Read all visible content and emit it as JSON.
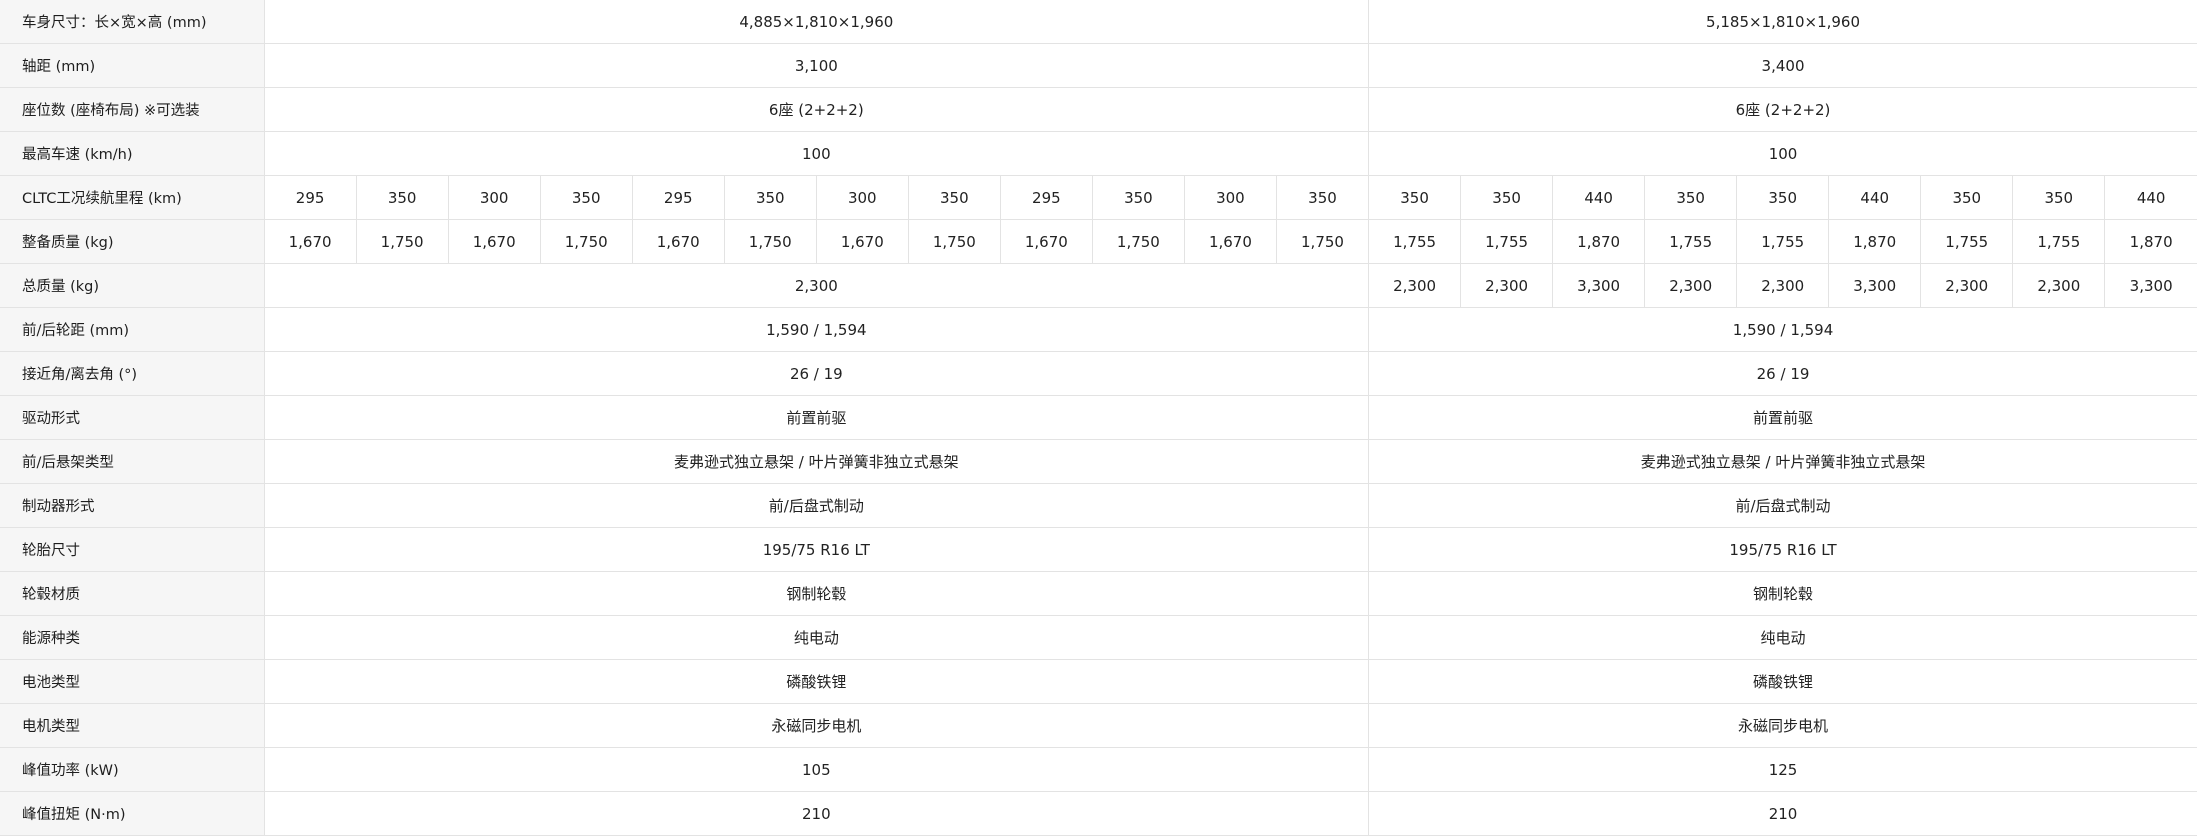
{
  "rows": [
    {
      "label": "车身尺寸：长×宽×高 (mm)",
      "type": "span",
      "left": "4,885×1,810×1,960",
      "right": "5,185×1,810×1,960"
    },
    {
      "label": "轴距 (mm)",
      "type": "span",
      "left": "3,100",
      "right": "3,400"
    },
    {
      "label": "座位数 (座椅布局) ※可选装",
      "type": "span",
      "left": "6座 (2+2+2)",
      "right": "6座 (2+2+2)"
    },
    {
      "label": "最高车速 (km/h)",
      "type": "span",
      "left": "100",
      "right": "100"
    },
    {
      "label": "CLTC工况续航里程 (km)",
      "type": "cells",
      "left": [
        "295",
        "350",
        "300",
        "350",
        "295",
        "350",
        "300",
        "350",
        "295",
        "350",
        "300",
        "350"
      ],
      "right": [
        "350",
        "350",
        "440",
        "350",
        "350",
        "440",
        "350",
        "350",
        "440"
      ]
    },
    {
      "label": "整备质量 (kg)",
      "type": "cells",
      "left": [
        "1,670",
        "1,750",
        "1,670",
        "1,750",
        "1,670",
        "1,750",
        "1,670",
        "1,750",
        "1,670",
        "1,750",
        "1,670",
        "1,750"
      ],
      "right": [
        "1,755",
        "1,755",
        "1,870",
        "1,755",
        "1,755",
        "1,870",
        "1,755",
        "1,755",
        "1,870"
      ]
    },
    {
      "label": "总质量 (kg)",
      "type": "mixed",
      "left": "2,300",
      "right": [
        "2,300",
        "2,300",
        "3,300",
        "2,300",
        "2,300",
        "3,300",
        "2,300",
        "2,300",
        "3,300"
      ]
    },
    {
      "label": "前/后轮距 (mm)",
      "type": "span",
      "left": "1,590 / 1,594",
      "right": "1,590 / 1,594"
    },
    {
      "label": "接近角/离去角 (°)",
      "type": "span",
      "left": "26 / 19",
      "right": "26 / 19"
    },
    {
      "label": "驱动形式",
      "type": "span",
      "left": "前置前驱",
      "right": "前置前驱"
    },
    {
      "label": "前/后悬架类型",
      "type": "span",
      "left": "麦弗逊式独立悬架 / 叶片弹簧非独立式悬架",
      "right": "麦弗逊式独立悬架 / 叶片弹簧非独立式悬架"
    },
    {
      "label": "制动器形式",
      "type": "span",
      "left": "前/后盘式制动",
      "right": "前/后盘式制动"
    },
    {
      "label": "轮胎尺寸",
      "type": "span",
      "left": "195/75 R16 LT",
      "right": "195/75 R16 LT"
    },
    {
      "label": "轮毂材质",
      "type": "span",
      "left": "钢制轮毂",
      "right": "钢制轮毂"
    },
    {
      "label": "能源种类",
      "type": "span",
      "left": "纯电动",
      "right": "纯电动"
    },
    {
      "label": "电池类型",
      "type": "span",
      "left": "磷酸铁锂",
      "right": "磷酸铁锂"
    },
    {
      "label": "电机类型",
      "type": "span",
      "left": "永磁同步电机",
      "right": "永磁同步电机"
    },
    {
      "label": "峰值功率 (kW)",
      "type": "span",
      "left": "105",
      "right": "125"
    },
    {
      "label": "峰值扭矩 (N·m)",
      "type": "span",
      "left": "210",
      "right": "210"
    }
  ]
}
